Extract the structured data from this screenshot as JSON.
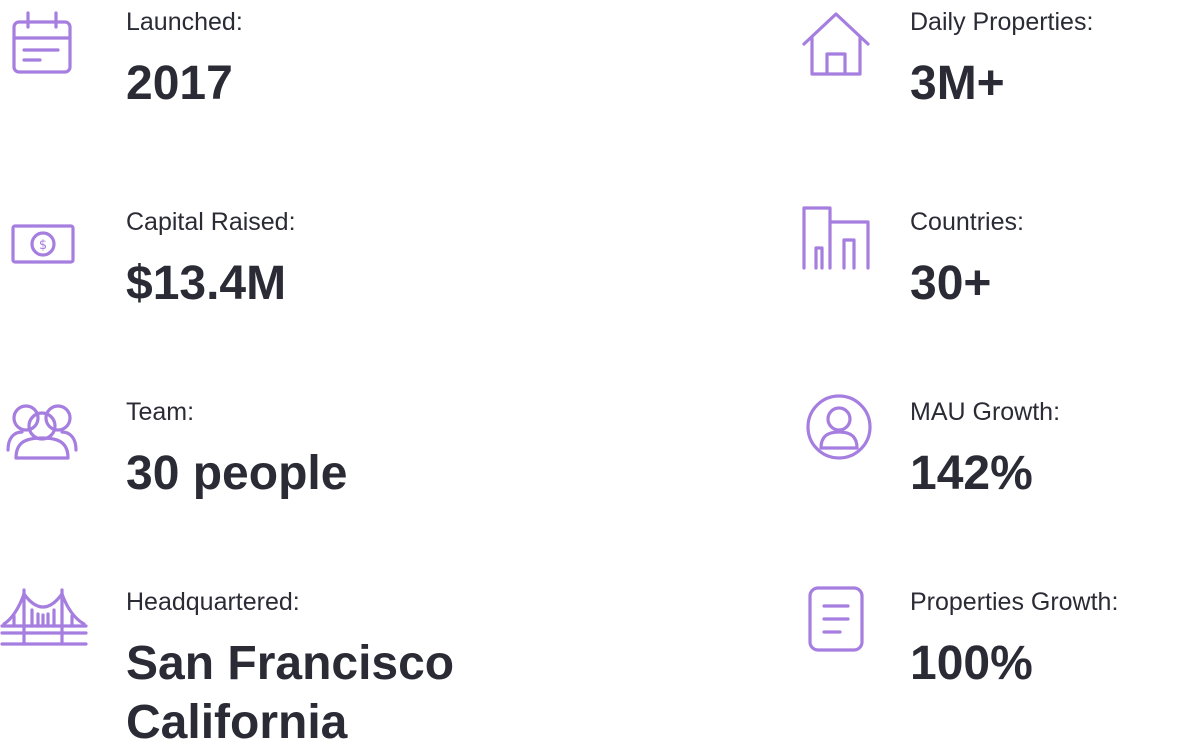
{
  "accent_color": "#a57ee0",
  "text_color": "#2b2b36",
  "stats_left": [
    {
      "icon": "calendar-icon",
      "label": "Launched:",
      "value": "2017"
    },
    {
      "icon": "cash-icon",
      "label": "Capital Raised:",
      "value": "$13.4M"
    },
    {
      "icon": "team-icon",
      "label": "Team:",
      "value": "30 people"
    },
    {
      "icon": "bridge-icon",
      "label": "Headquartered:",
      "value": "San Francisco",
      "value_line2": "California"
    }
  ],
  "stats_right": [
    {
      "icon": "house-icon",
      "label": "Daily Properties:",
      "value": "3M+"
    },
    {
      "icon": "buildings-icon",
      "label": "Countries:",
      "value": "30+"
    },
    {
      "icon": "user-circle-icon",
      "label": "MAU Growth:",
      "value": "142%"
    },
    {
      "icon": "document-icon",
      "label": "Properties Growth:",
      "value": "100%"
    }
  ]
}
